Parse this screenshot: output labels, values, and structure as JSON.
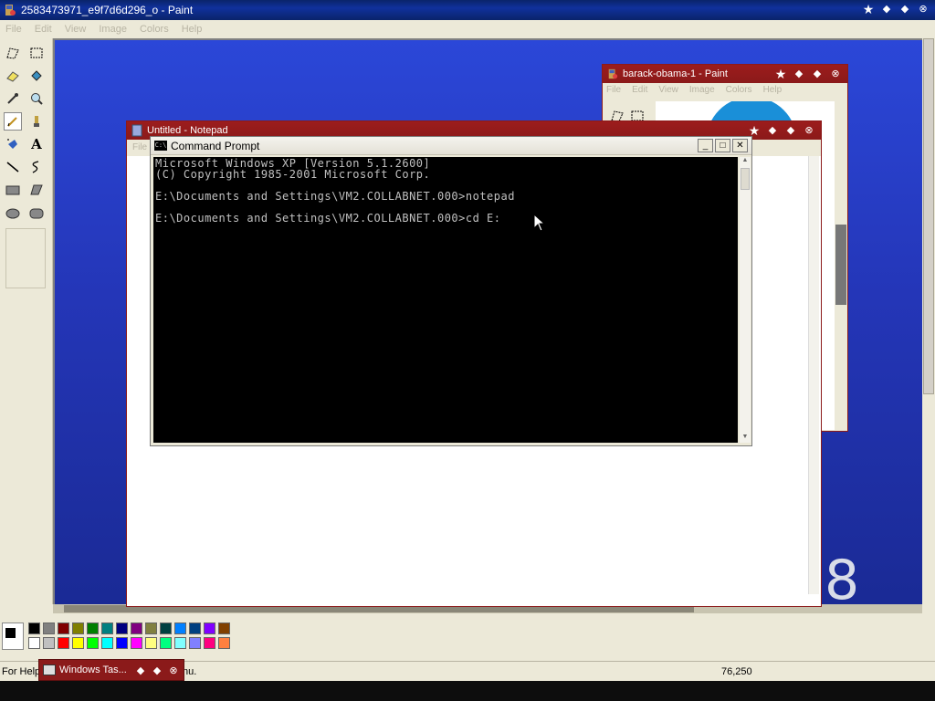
{
  "paint": {
    "title": "2583473971_e9f7d6d296_o - Paint",
    "menu": [
      "File",
      "Edit",
      "View",
      "Image",
      "Colors",
      "Help"
    ],
    "status_help": "For Help",
    "status_help_tail": "nu.",
    "coords": "76,250"
  },
  "palette": {
    "primary": "#000000",
    "colors_row1": [
      "#000000",
      "#808080",
      "#800000",
      "#808000",
      "#008000",
      "#008080",
      "#000080",
      "#800080",
      "#808040",
      "#004040",
      "#0080ff",
      "#004080",
      "#8000ff",
      "#804000"
    ],
    "colors_row2": [
      "#ffffff",
      "#c0c0c0",
      "#ff0000",
      "#ffff00",
      "#00ff00",
      "#00ffff",
      "#0000ff",
      "#ff00ff",
      "#ffff80",
      "#00ff80",
      "#80ffff",
      "#8080ff",
      "#ff0080",
      "#ff8040"
    ]
  },
  "obama_window": {
    "title": "barack-obama-1 - Paint",
    "menu": [
      "File",
      "Edit",
      "View",
      "Image",
      "Colors",
      "Help"
    ]
  },
  "notepad": {
    "title": "Untitled - Notepad",
    "menu_first": "File",
    "digit": "8"
  },
  "cmd": {
    "title": "Command Prompt",
    "lines": "Microsoft Windows XP [Version 5.1.2600]\n(C) Copyright 1985-2001 Microsoft Corp.\n\nE:\\Documents and Settings\\VM2.COLLABNET.000>notepad\n\nE:\\Documents and Settings\\VM2.COLLABNET.000>cd E:"
  },
  "taskmgr": {
    "title": "Windows Tas..."
  }
}
